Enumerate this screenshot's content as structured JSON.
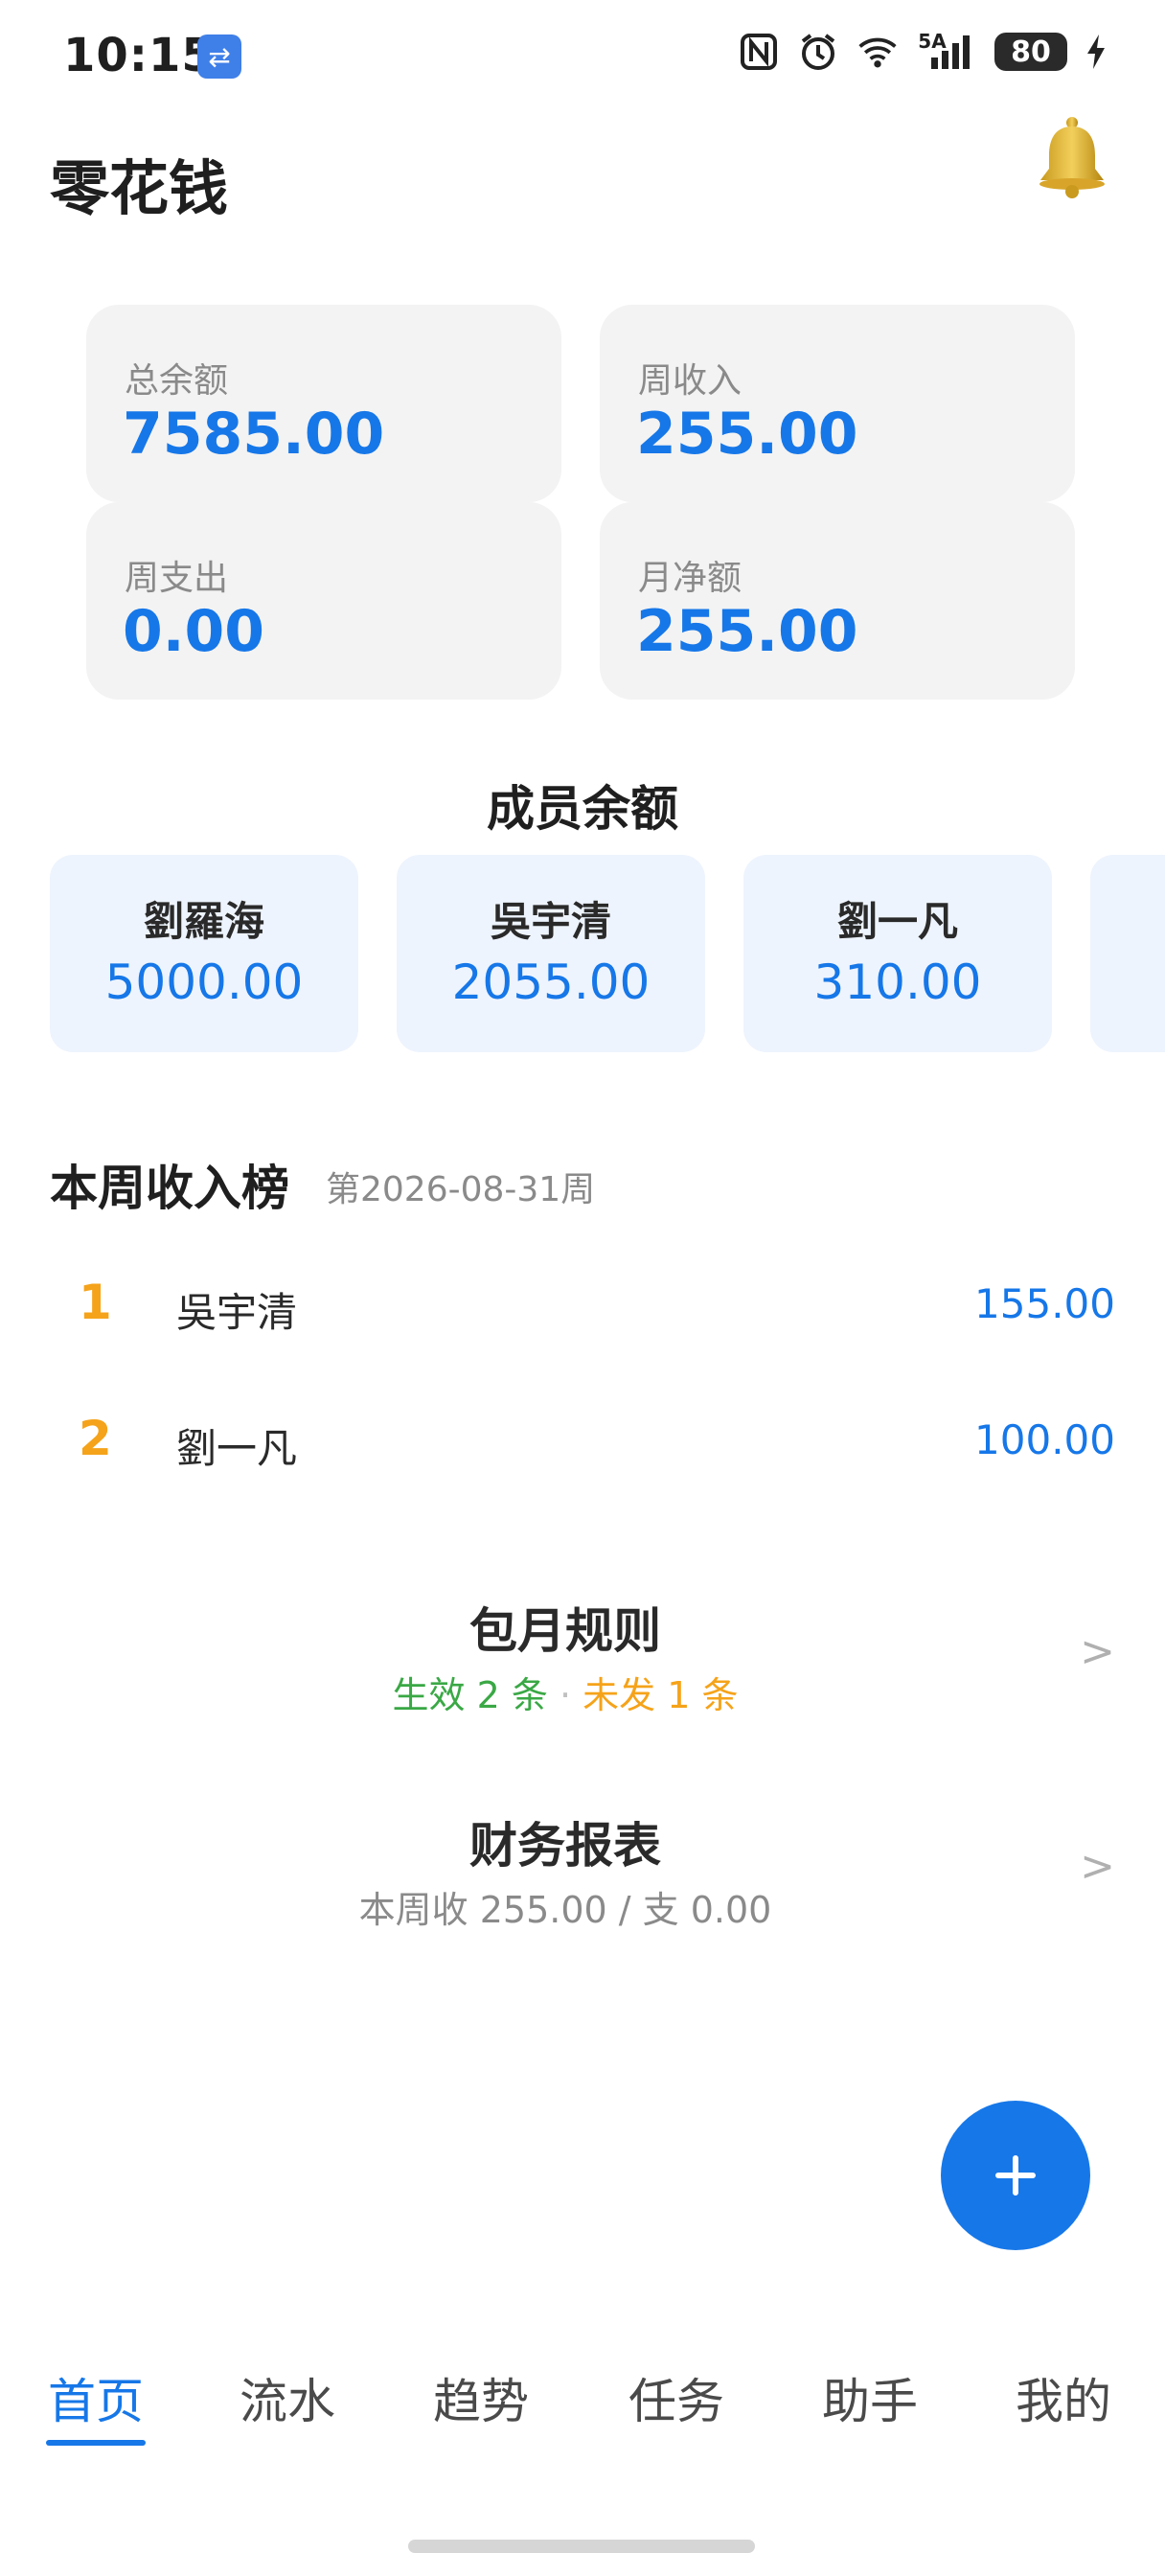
{
  "status_bar": {
    "time": "10:15",
    "icons": [
      "usb-icon",
      "nfc-icon",
      "alarm-icon",
      "wifi-icon",
      "signal-5a-icon",
      "battery-icon",
      "charging-icon"
    ],
    "network_label": "5A",
    "battery": "80"
  },
  "header": {
    "title": "零花钱"
  },
  "summary": {
    "total_balance": {
      "label": "总余额",
      "value": "7585.00"
    },
    "week_income": {
      "label": "周收入",
      "value": "255.00"
    },
    "week_expense": {
      "label": "周支出",
      "value": "0.00"
    },
    "month_net": {
      "label": "月净额",
      "value": "255.00"
    }
  },
  "members": {
    "title": "成员余额",
    "items": [
      {
        "name": "劉羅海",
        "balance": "5000.00"
      },
      {
        "name": "吳宇清",
        "balance": "2055.00"
      },
      {
        "name": "劉一凡",
        "balance": "310.00"
      }
    ]
  },
  "ranking": {
    "title": "本周收入榜",
    "week": "第2026-08-31周",
    "rows": [
      {
        "rank": "1",
        "name": "吳宇清",
        "amount": "155.00"
      },
      {
        "rank": "2",
        "name": "劉一凡",
        "amount": "100.00"
      }
    ]
  },
  "monthly_rules": {
    "title": "包月规则",
    "active": "生效 2 条",
    "separator": "·",
    "pending": "未发 1 条",
    "chevron": ">"
  },
  "report": {
    "title": "财务报表",
    "summary": "本周收 255.00 / 支 0.00",
    "chevron": ">"
  },
  "fab": {
    "label": "+"
  },
  "nav": {
    "items": [
      "首页",
      "流水",
      "趋势",
      "任务",
      "助手",
      "我的"
    ],
    "active_index": 0
  },
  "colors": {
    "accent": "#1677e8",
    "rank": "#f5a31a",
    "active_green": "#3aa845"
  }
}
